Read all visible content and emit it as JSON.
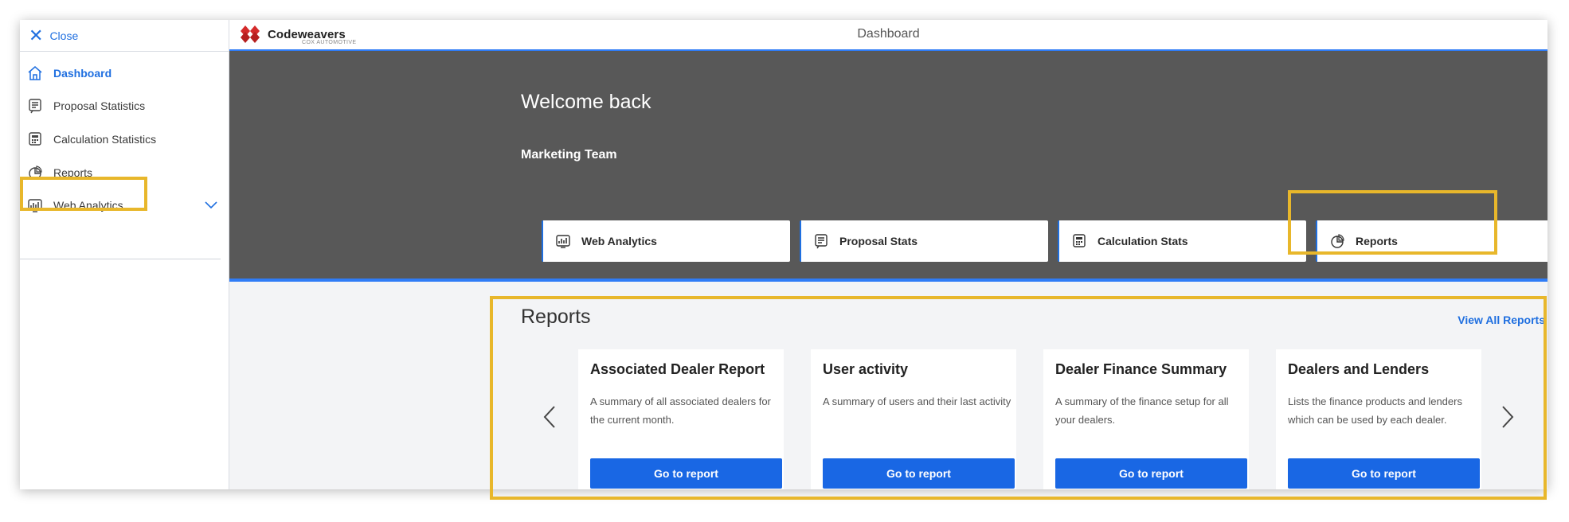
{
  "sidebar": {
    "close_label": "Close",
    "items": [
      {
        "label": "Dashboard",
        "icon": "home-icon"
      },
      {
        "label": "Proposal Statistics",
        "icon": "document-lines-icon"
      },
      {
        "label": "Calculation Statistics",
        "icon": "calculator-icon"
      },
      {
        "label": "Reports",
        "icon": "pie-chart-icon"
      },
      {
        "label": "Web Analytics",
        "icon": "analytics-chart-icon"
      }
    ]
  },
  "header": {
    "brand": "Codeweavers",
    "brand_sub": "COX AUTOMOTIVE",
    "title": "Dashboard"
  },
  "hero": {
    "welcome": "Welcome back",
    "team": "Marketing Team",
    "quick_links": [
      {
        "label": "Web Analytics",
        "icon": "analytics-chart-icon"
      },
      {
        "label": "Proposal Stats",
        "icon": "document-lines-icon"
      },
      {
        "label": "Calculation Stats",
        "icon": "calculator-icon"
      },
      {
        "label": "Reports",
        "icon": "pie-chart-icon"
      }
    ]
  },
  "reports": {
    "heading": "Reports",
    "view_all": "View All Reports",
    "cards": [
      {
        "title": "Associated Dealer Report",
        "description": "A summary of all associated dealers for the current month.",
        "button": "Go to report"
      },
      {
        "title": "User activity",
        "description": "A summary of users and their last activity",
        "button": "Go to report"
      },
      {
        "title": "Dealer Finance Summary",
        "description": "A summary of the finance setup for all your dealers.",
        "button": "Go to report"
      },
      {
        "title": "Dealers and Lenders",
        "description": "Lists the finance products and lenders which can be used by each dealer.",
        "button": "Go to report"
      }
    ]
  },
  "colors": {
    "accent": "#1f6fe0",
    "hero_bg": "#585858",
    "highlight": "#e8b72b",
    "button": "#1967e4",
    "logo_red": "#d42a2a"
  }
}
